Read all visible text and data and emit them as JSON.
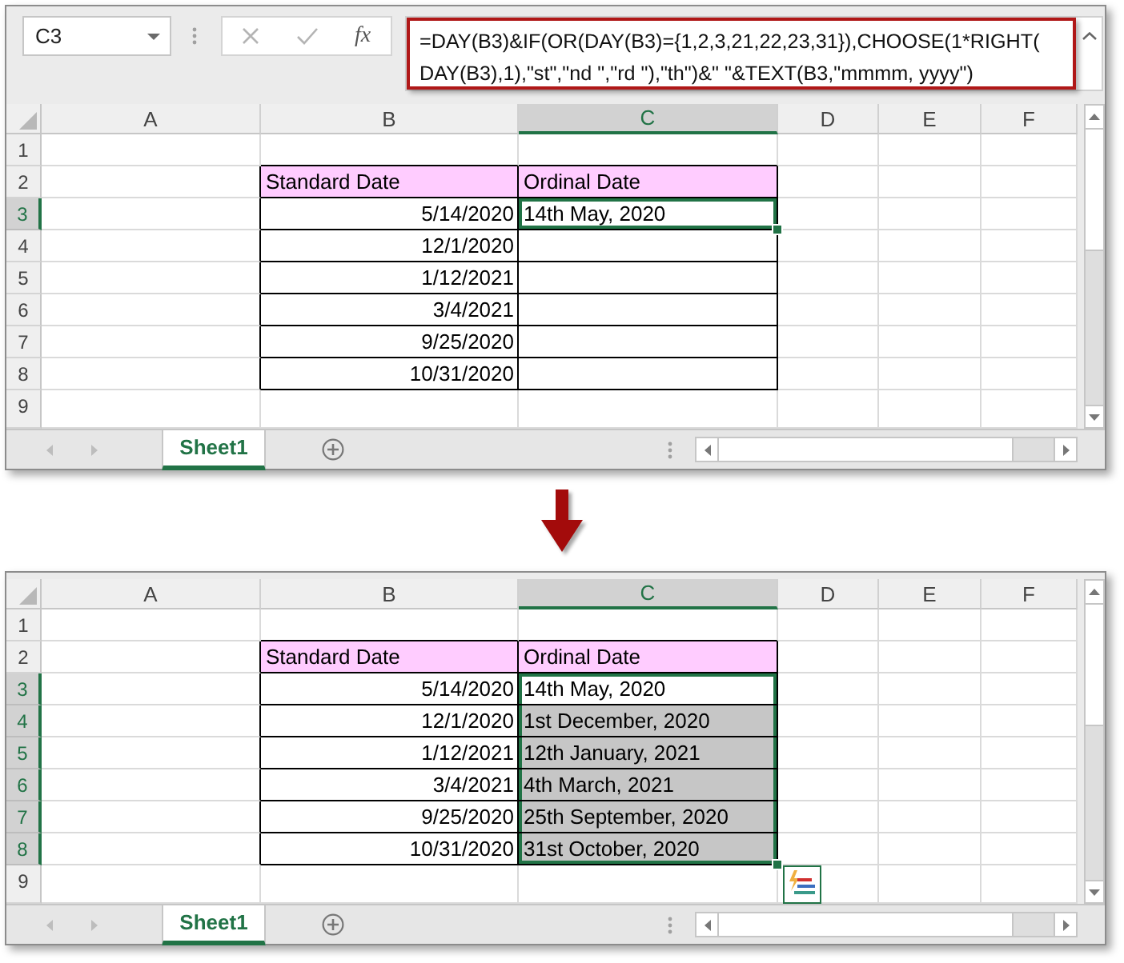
{
  "windows": [
    {
      "name_box": "C3",
      "formula_bar": {
        "function_label": "fx",
        "highlighted": true,
        "formula_lines": [
          "=DAY(B3)&IF(OR(DAY(B3)={1,2,3,21,22,23,31}),CHOOSE(1*RIGHT(",
          "DAY(B3),1),\"st\",\"nd \",\"rd \"),\"th\")&\" \"&TEXT(B3,\"mmmm, yyyy\")"
        ]
      },
      "columns": [
        {
          "label": "A",
          "selected": false
        },
        {
          "label": "B",
          "selected": false
        },
        {
          "label": "C",
          "selected": true
        },
        {
          "label": "D",
          "selected": false
        },
        {
          "label": "E",
          "selected": false
        },
        {
          "label": "F",
          "selected": false
        }
      ],
      "rows": [
        {
          "number": "1",
          "selected": false
        },
        {
          "number": "2",
          "selected": false,
          "b": {
            "kind": "heading",
            "text": "Standard Date"
          },
          "c": {
            "kind": "heading",
            "text": "Ordinal Date",
            "selected": false,
            "highlighted": false
          }
        },
        {
          "number": "3",
          "selected": true,
          "b": {
            "kind": "date",
            "text": "5/14/2020"
          },
          "c": {
            "kind": "text",
            "text": "14th May, 2020",
            "selected": true,
            "highlighted": false
          }
        },
        {
          "number": "4",
          "selected": false,
          "b": {
            "kind": "date",
            "text": "12/1/2020"
          },
          "c": {
            "kind": "text",
            "selected": false,
            "highlighted": false
          }
        },
        {
          "number": "5",
          "selected": false,
          "b": {
            "kind": "date",
            "text": "1/12/2021"
          },
          "c": {
            "kind": "text",
            "selected": false,
            "highlighted": false
          }
        },
        {
          "number": "6",
          "selected": false,
          "b": {
            "kind": "date",
            "text": "3/4/2021"
          },
          "c": {
            "kind": "text",
            "selected": false,
            "highlighted": false
          }
        },
        {
          "number": "7",
          "selected": false,
          "b": {
            "kind": "date",
            "text": "9/25/2020"
          },
          "c": {
            "kind": "text",
            "selected": false,
            "highlighted": false
          }
        },
        {
          "number": "8",
          "selected": false,
          "b": {
            "kind": "date",
            "text": "10/31/2020"
          },
          "c": {
            "kind": "text",
            "selected": false,
            "highlighted": false
          }
        },
        {
          "number": "9",
          "selected": false
        }
      ],
      "fill_options_button": false,
      "sheet_tabs": [
        {
          "label": "Sheet1",
          "selected": true
        }
      ]
    },
    {
      "columns": [
        {
          "label": "A",
          "selected": false
        },
        {
          "label": "B",
          "selected": false
        },
        {
          "label": "C",
          "selected": true
        },
        {
          "label": "D",
          "selected": false
        },
        {
          "label": "E",
          "selected": false
        },
        {
          "label": "F",
          "selected": false
        }
      ],
      "rows": [
        {
          "number": "1",
          "selected": false
        },
        {
          "number": "2",
          "selected": false,
          "b": {
            "kind": "heading",
            "text": "Standard Date"
          },
          "c": {
            "kind": "heading",
            "text": "Ordinal Date",
            "selected": false,
            "highlighted": false
          }
        },
        {
          "number": "3",
          "selected": true,
          "b": {
            "kind": "date",
            "text": "5/14/2020"
          },
          "c": {
            "kind": "text",
            "text": "14th May, 2020",
            "selected": true,
            "highlighted": false
          }
        },
        {
          "number": "4",
          "selected": true,
          "b": {
            "kind": "date",
            "text": "12/1/2020"
          },
          "c": {
            "kind": "text",
            "text": "1st December, 2020",
            "selected": true,
            "highlighted": true
          }
        },
        {
          "number": "5",
          "selected": true,
          "b": {
            "kind": "date",
            "text": "1/12/2021"
          },
          "c": {
            "kind": "text",
            "text": "12th January, 2021",
            "selected": true,
            "highlighted": true
          }
        },
        {
          "number": "6",
          "selected": true,
          "b": {
            "kind": "date",
            "text": "3/4/2021"
          },
          "c": {
            "kind": "text",
            "text": "4th March, 2021",
            "selected": true,
            "highlighted": true
          }
        },
        {
          "number": "7",
          "selected": true,
          "b": {
            "kind": "date",
            "text": "9/25/2020"
          },
          "c": {
            "kind": "text",
            "text": "25th September, 2020",
            "selected": true,
            "highlighted": true
          }
        },
        {
          "number": "8",
          "selected": true,
          "b": {
            "kind": "date",
            "text": "10/31/2020"
          },
          "c": {
            "kind": "text",
            "text": "31st October, 2020",
            "selected": true,
            "highlighted": true
          }
        },
        {
          "number": "9",
          "selected": false
        }
      ],
      "fill_options_button": true,
      "sheet_tabs": [
        {
          "label": "Sheet1",
          "selected": true
        }
      ]
    }
  ]
}
